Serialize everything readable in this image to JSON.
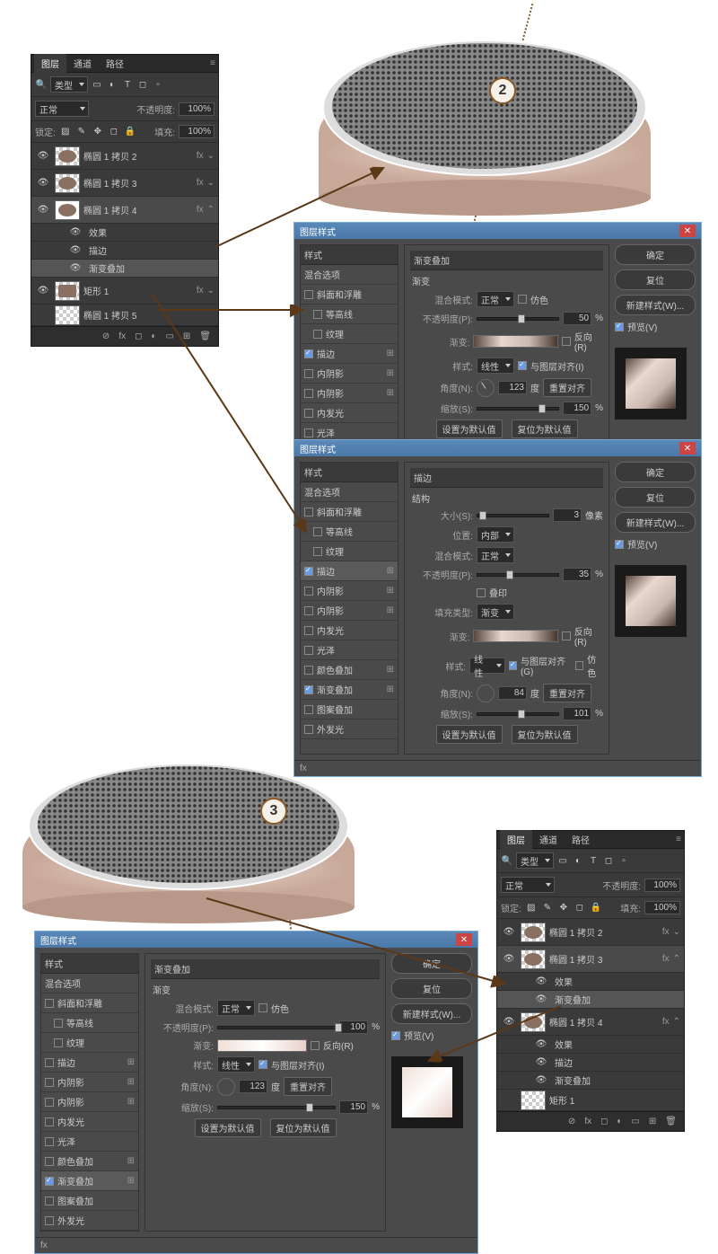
{
  "markers": {
    "m2": "2",
    "m3": "3"
  },
  "layers_panel": {
    "tabs": {
      "layers": "图层",
      "channels": "通道",
      "paths": "路径"
    },
    "filter": "类型",
    "blend": "正常",
    "opacity_lbl": "不透明度:",
    "opacity": "100%",
    "lock_lbl": "锁定:",
    "fill_lbl": "填充:",
    "fill": "100%",
    "items": [
      "椭圆 1 拷贝 2",
      "椭圆 1 拷贝 3",
      "椭圆 1 拷贝 4",
      "矩形 1",
      "椭圆 1 拷贝 5"
    ],
    "fx": "fx",
    "effects": "效果",
    "stroke": "描边",
    "grad_overlay": "渐变叠加"
  },
  "dlg": {
    "title": "图层样式",
    "styles": "样式",
    "blend_opts": "混合选项",
    "bevel": "斜面和浮雕",
    "contour": "等高线",
    "texture": "纹理",
    "stroke": "描边",
    "inner_shadow": "内阴影",
    "inner_glow": "内发光",
    "satin": "光泽",
    "color_overlay": "颜色叠加",
    "grad_overlay": "渐变叠加",
    "pattern_overlay": "图案叠加",
    "outer_glow": "外发光",
    "ok": "确定",
    "cancel": "复位",
    "new_style": "新建样式(W)...",
    "preview": "预览(V)",
    "section_grad": "渐变",
    "section_stroke": "结构",
    "blend_mode": "混合模式:",
    "normal": "正常",
    "dither": "仿色",
    "opacity": "不透明度(P):",
    "gradient": "渐变:",
    "reverse": "反向(R)",
    "style": "样式:",
    "linear": "线性",
    "align": "与图层对齐(I)",
    "angle": "角度(N):",
    "deg": "度",
    "reset_align": "重置对齐",
    "scale": "缩放(S):",
    "size": "大小(S):",
    "px": "像素",
    "position": "位置:",
    "inside": "内部",
    "fill_type": "填充类型:",
    "grad_fill": "渐变",
    "overprint": "叠印",
    "align_g": "与图层对齐(G)",
    "set_default": "设置为默认值",
    "reset_default": "复位为默认值"
  },
  "vals": {
    "d1": {
      "opacity": "50",
      "angle": "123",
      "scale": "150"
    },
    "d2": {
      "size": "3",
      "opacity": "35",
      "angle": "84",
      "scale": "101"
    },
    "d3": {
      "opacity": "100",
      "angle": "123",
      "scale": "150"
    }
  }
}
